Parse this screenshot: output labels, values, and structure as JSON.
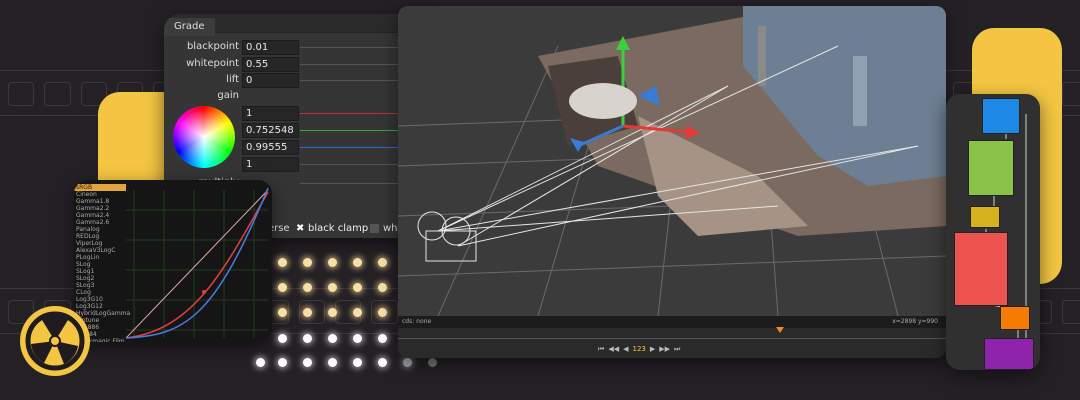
{
  "grade_panel": {
    "tab_label": "Grade",
    "params": [
      {
        "label": "blackpoint",
        "value": "0.01"
      },
      {
        "label": "whitepoint",
        "value": "0.55"
      },
      {
        "label": "lift",
        "value": "0"
      },
      {
        "label": "gain",
        "value": ""
      }
    ],
    "gain_values": [
      "1",
      "0.752548",
      "0.99555",
      "1"
    ],
    "multiply_label": "multiply",
    "options": {
      "reverse_label": "reverse",
      "black_clamp_label": "black clamp",
      "white_clamp_label": "white"
    }
  },
  "lut_list": {
    "items": [
      "sRGB",
      "Cineon",
      "Gamma1.8",
      "Gamma2.2",
      "Gamma2.4",
      "Gamma2.6",
      "Panalog",
      "REDLog",
      "ViperLog",
      "AlexaV3LogC",
      "PLogLin",
      "SLog",
      "SLog1",
      "SLog2",
      "SLog3",
      "CLog",
      "Log3G10",
      "Log3G12",
      "HybridLogGamma",
      "Protune",
      "BT1886",
      "st2084",
      "Blackmagic Film"
    ],
    "selected_index": 0
  },
  "viewer": {
    "status_left": "cds: none",
    "status_right": "x=2898 y=990",
    "frame_value": "123"
  },
  "colors": {
    "background": "#242125",
    "accent_yellow": "#f4c542",
    "node_blue": "#1e88e5",
    "node_green": "#8bc34a",
    "node_yellow": "#d6b21f",
    "node_red": "#ef5350",
    "node_orange": "#f57c00",
    "node_purple": "#8e24aa"
  },
  "icons": {
    "logo": "nuke-logo-icon"
  }
}
